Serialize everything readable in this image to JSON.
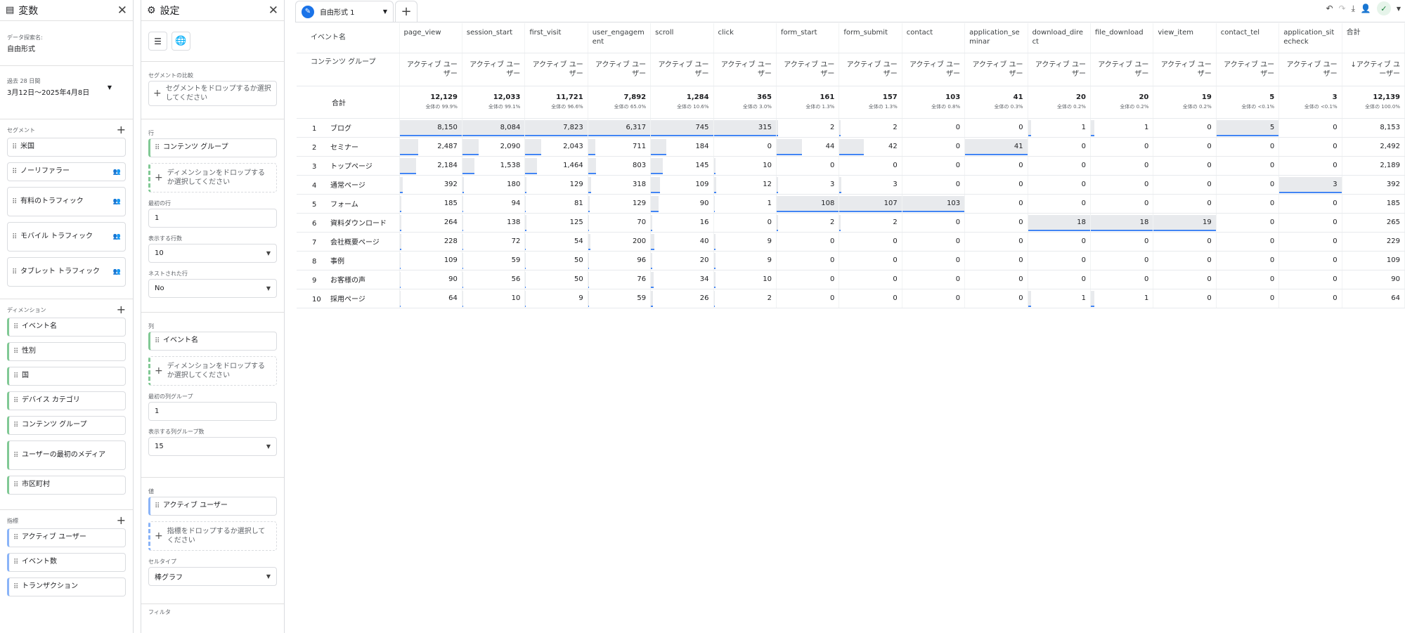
{
  "variables_panel": {
    "title": "変数",
    "explore_name_label": "データ探索名:",
    "explore_name": "自由形式",
    "date_range_label": "過去 28 日間",
    "date_range": "3月12日～2025年4月8日",
    "segments_title": "セグメント",
    "segments": [
      "米国",
      "ノーリファラー",
      "有料のトラフィック",
      "モバイル トラフィック",
      "タブレット トラフィック"
    ],
    "dimensions_title": "ディメンション",
    "dimensions": [
      "イベント名",
      "性別",
      "国",
      "デバイス カテゴリ",
      "コンテンツ グループ",
      "ユーザーの最初のメディア",
      "市区町村"
    ],
    "metrics_title": "指標",
    "metrics": [
      "アクティブ ユーザー",
      "イベント数",
      "トランザクション"
    ]
  },
  "settings_panel": {
    "title": "設定",
    "segment_compare_label": "セグメントの比較",
    "segment_drop": "セグメントをドロップするか選択してください",
    "rows_label": "行",
    "row_dim": "コンテンツ グループ",
    "dim_drop": "ディメンションをドロップするか選択してください",
    "start_row_label": "最初の行",
    "start_row": "1",
    "show_rows_label": "表示する行数",
    "show_rows": "10",
    "nested_rows_label": "ネストされた行",
    "nested_rows": "No",
    "columns_label": "列",
    "col_dim": "イベント名",
    "col_drop": "ディメンションをドロップするか選択してください",
    "start_col_group_label": "最初の列グループ",
    "start_col_group": "1",
    "show_col_groups_label": "表示する列グループ数",
    "show_col_groups": "15",
    "values_label": "値",
    "value_metric": "アクティブ ユーザー",
    "metric_drop": "指標をドロップするか選択してください",
    "cell_type_label": "セルタイプ",
    "cell_type": "棒グラフ",
    "filter_label": "フィルタ"
  },
  "tab": {
    "label": "自由形式 1"
  },
  "table": {
    "dim_col_header": "イベント名",
    "row_dim_header": "コンテンツ グループ",
    "metric_label": "アクティブ ユーザー",
    "total_metric_label": "↓アクティブ ユーザー",
    "total_label": "合計",
    "columns": [
      {
        "name": "page_view",
        "total": "12,129",
        "pct": "全体の 99.9%"
      },
      {
        "name": "session_start",
        "total": "12,033",
        "pct": "全体の 99.1%"
      },
      {
        "name": "first_visit",
        "total": "11,721",
        "pct": "全体の 96.6%"
      },
      {
        "name": "user_engagement",
        "total": "7,892",
        "pct": "全体の 65.0%"
      },
      {
        "name": "scroll",
        "total": "1,284",
        "pct": "全体の 10.6%"
      },
      {
        "name": "click",
        "total": "365",
        "pct": "全体の 3.0%"
      },
      {
        "name": "form_start",
        "total": "161",
        "pct": "全体の 1.3%"
      },
      {
        "name": "form_submit",
        "total": "157",
        "pct": "全体の 1.3%"
      },
      {
        "name": "contact",
        "total": "103",
        "pct": "全体の 0.8%"
      },
      {
        "name": "application_seminar",
        "total": "41",
        "pct": "全体の 0.3%"
      },
      {
        "name": "download_direct",
        "total": "20",
        "pct": "全体の 0.2%"
      },
      {
        "name": "file_download",
        "total": "20",
        "pct": "全体の 0.2%"
      },
      {
        "name": "view_item",
        "total": "19",
        "pct": "全体の 0.2%"
      },
      {
        "name": "contact_tel",
        "total": "5",
        "pct": "全体の <0.1%"
      },
      {
        "name": "application_sitecheck",
        "total": "3",
        "pct": "全体の <0.1%"
      },
      {
        "name": "合計",
        "total": "12,139",
        "pct": "全体の 100.0%"
      }
    ],
    "rows": [
      {
        "idx": "1",
        "name": "ブログ",
        "values": [
          "8,150",
          "8,084",
          "7,823",
          "6,317",
          "745",
          "315",
          "2",
          "2",
          "0",
          "0",
          "1",
          "1",
          "0",
          "5",
          "0",
          "8,153"
        ]
      },
      {
        "idx": "2",
        "name": "セミナー",
        "values": [
          "2,487",
          "2,090",
          "2,043",
          "711",
          "184",
          "0",
          "44",
          "42",
          "0",
          "41",
          "0",
          "0",
          "0",
          "0",
          "0",
          "2,492"
        ]
      },
      {
        "idx": "3",
        "name": "トップページ",
        "values": [
          "2,184",
          "1,538",
          "1,464",
          "803",
          "145",
          "10",
          "0",
          "0",
          "0",
          "0",
          "0",
          "0",
          "0",
          "0",
          "0",
          "2,189"
        ]
      },
      {
        "idx": "4",
        "name": "通常ページ",
        "values": [
          "392",
          "180",
          "129",
          "318",
          "109",
          "12",
          "3",
          "3",
          "0",
          "0",
          "0",
          "0",
          "0",
          "0",
          "3",
          "392"
        ]
      },
      {
        "idx": "5",
        "name": "フォーム",
        "values": [
          "185",
          "94",
          "81",
          "129",
          "90",
          "1",
          "108",
          "107",
          "103",
          "0",
          "0",
          "0",
          "0",
          "0",
          "0",
          "185"
        ]
      },
      {
        "idx": "6",
        "name": "資料ダウンロード",
        "values": [
          "264",
          "138",
          "125",
          "70",
          "16",
          "0",
          "2",
          "2",
          "0",
          "0",
          "18",
          "18",
          "19",
          "0",
          "0",
          "265"
        ]
      },
      {
        "idx": "7",
        "name": "会社概要ページ",
        "values": [
          "228",
          "72",
          "54",
          "200",
          "40",
          "9",
          "0",
          "0",
          "0",
          "0",
          "0",
          "0",
          "0",
          "0",
          "0",
          "229"
        ]
      },
      {
        "idx": "8",
        "name": "事例",
        "values": [
          "109",
          "59",
          "50",
          "96",
          "20",
          "9",
          "0",
          "0",
          "0",
          "0",
          "0",
          "0",
          "0",
          "0",
          "0",
          "109"
        ]
      },
      {
        "idx": "9",
        "name": "お客様の声",
        "values": [
          "90",
          "56",
          "50",
          "76",
          "34",
          "10",
          "0",
          "0",
          "0",
          "0",
          "0",
          "0",
          "0",
          "0",
          "0",
          "90"
        ]
      },
      {
        "idx": "10",
        "name": "採用ページ",
        "values": [
          "64",
          "10",
          "9",
          "59",
          "26",
          "2",
          "0",
          "0",
          "0",
          "0",
          "1",
          "1",
          "0",
          "0",
          "0",
          "64"
        ]
      }
    ]
  }
}
